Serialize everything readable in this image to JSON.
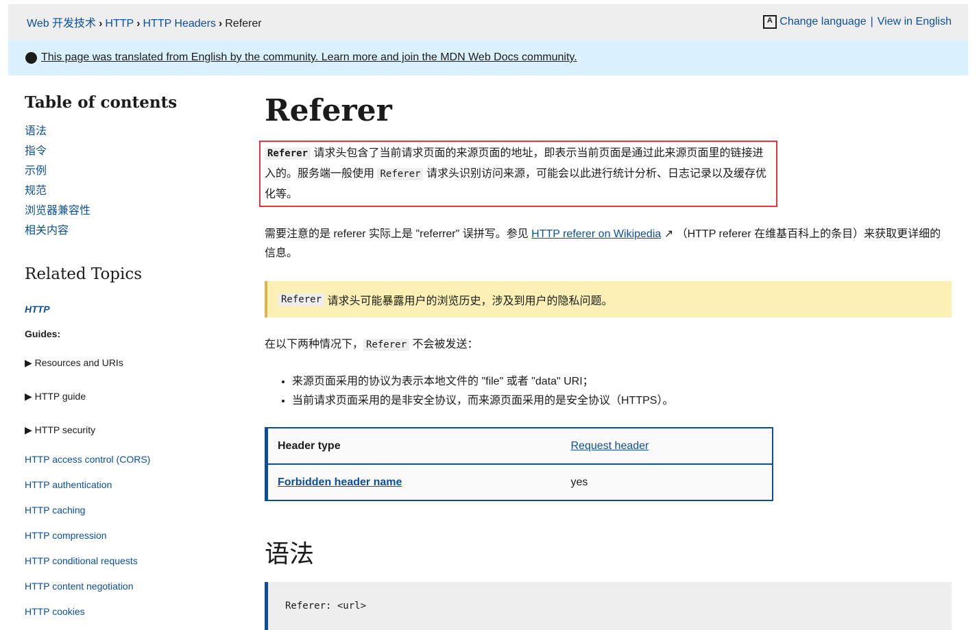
{
  "breadcrumb": [
    "Web 开发技术",
    "HTTP",
    "HTTP Headers",
    "Referer"
  ],
  "lang": {
    "change": "Change language",
    "view_english": "View in English"
  },
  "banner": "This page was translated from English by the community. Learn more and join the MDN Web Docs community.",
  "toc": {
    "title": "Table of contents",
    "items": [
      "语法",
      "指令",
      "示例",
      "规范",
      "浏览器兼容性",
      "相关内容"
    ]
  },
  "related": {
    "title": "Related Topics",
    "http": "HTTP",
    "guides": "Guides:",
    "expanders": [
      "Resources and URIs",
      "HTTP guide",
      "HTTP security"
    ],
    "links": [
      "HTTP access control (CORS)",
      "HTTP authentication",
      "HTTP caching",
      "HTTP compression",
      "HTTP conditional requests",
      "HTTP content negotiation",
      "HTTP cookies"
    ]
  },
  "main": {
    "title": "Referer",
    "code": "Referer",
    "p1a": "请求头包含了当前请求页面的来源页面的地址，即表示当前页面是通过此来源页面里的链接进入的。服务端一般使用",
    "p1b": "请求头识别访问来源，可能会以此进行统计分析、日志记录以及缓存优化等。",
    "p2a": "需要注意的是 referer 实际上是 \"referrer\" 误拼写。参见 ",
    "p2link": "HTTP referer on Wikipedia",
    "p2b": "（HTTP referer 在维基百科上的条目）来获取更详细的信息。",
    "note": "请求头可能暴露用户的浏览历史，涉及到用户的隐私问题。",
    "p3a": "在以下两种情况下，",
    "p3b": "不会被发送：",
    "bullets": [
      "来源页面采用的协议为表示本地文件的 \"file\" 或者 \"data\" URI；",
      "当前请求页面采用的是非安全协议，而来源页面采用的是安全协议（HTTPS）。"
    ],
    "table": [
      [
        "Header type",
        "Request header"
      ],
      [
        "Forbidden header name",
        "yes"
      ]
    ],
    "h2": "语法",
    "syntax": "Referer: <url>"
  }
}
